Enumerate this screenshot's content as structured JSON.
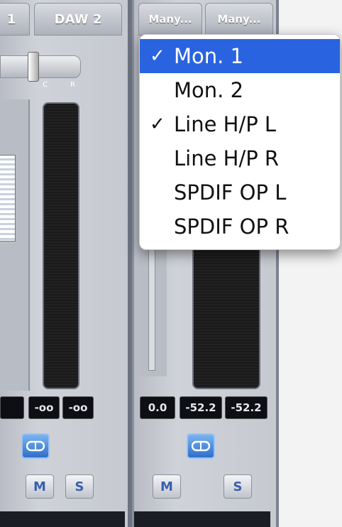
{
  "left_strip": {
    "tab_partial": "1",
    "tab_daw2": "DAW 2",
    "pan_left": "L",
    "pan_center": "C",
    "pan_right": "R",
    "readouts": [
      "-oo",
      "-oo"
    ],
    "mute_label": "M",
    "solo_label": "S"
  },
  "right_strip": {
    "tab1": "Many...",
    "tab2": "Many...",
    "readouts": [
      "0.0",
      "-52.2",
      "-52.2"
    ],
    "mute_label": "M",
    "solo_label": "S"
  },
  "dropdown": {
    "items": [
      {
        "label": "Mon. 1",
        "checked": true,
        "highlighted": true
      },
      {
        "label": "Mon. 2",
        "checked": false,
        "highlighted": false
      },
      {
        "label": "Line H/P L",
        "checked": true,
        "highlighted": false
      },
      {
        "label": "Line H/P R",
        "checked": false,
        "highlighted": false
      },
      {
        "label": "SPDIF OP L",
        "checked": false,
        "highlighted": false
      },
      {
        "label": "SPDIF OP R",
        "checked": false,
        "highlighted": false
      }
    ],
    "check_glyph": "✓"
  },
  "colors": {
    "highlight": "#2a63e0",
    "button_accent": "#3a5fae"
  }
}
